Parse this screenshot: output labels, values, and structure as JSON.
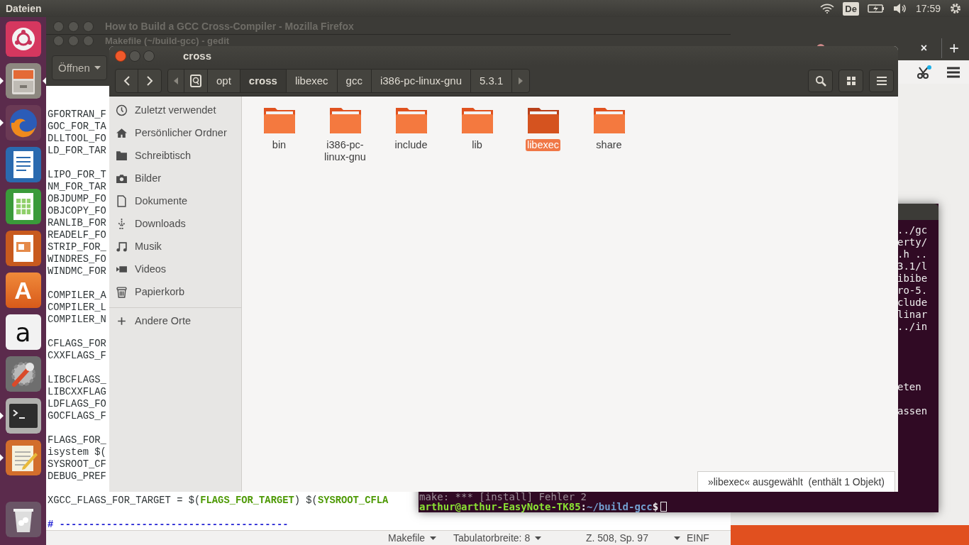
{
  "top_panel": {
    "app_name": "Dateien",
    "keyboard_layout": "De",
    "time": "17:59"
  },
  "launcher": [
    {
      "kind": "dash",
      "running": false,
      "focused": false
    },
    {
      "kind": "files",
      "running": true,
      "focused": true
    },
    {
      "kind": "browser",
      "running": true,
      "focused": false
    },
    {
      "kind": "writer",
      "running": false,
      "focused": false
    },
    {
      "kind": "calc",
      "running": false,
      "focused": false
    },
    {
      "kind": "impress",
      "running": false,
      "focused": false
    },
    {
      "kind": "software",
      "glyph": "A",
      "running": false,
      "focused": false
    },
    {
      "kind": "shop",
      "glyph": "a",
      "running": false,
      "focused": false
    },
    {
      "kind": "settings",
      "running": false,
      "focused": false
    },
    {
      "kind": "terminal",
      "running": true,
      "focused": false
    },
    {
      "kind": "editor",
      "running": true,
      "focused": false
    },
    {
      "kind": "trash",
      "running": false,
      "focused": false
    }
  ],
  "firefox": {
    "title": "How to Build a GCC Cross-Compiler - Mozilla Firefox",
    "tab_close": "×",
    "new_tab": "+"
  },
  "gedit": {
    "title": "Makefile (~/build-gcc) - gedit",
    "open_button": "Öffnen",
    "line_groups": [
      [
        "GFORTRAN_F",
        "GOC_FOR_TA",
        "DLLTOOL_FO",
        "LD_FOR_TAR"
      ],
      [
        "LIPO_FOR_T",
        "NM_FOR_TAR",
        "OBJDUMP_FO",
        "OBJCOPY_FO",
        "RANLIB_FOR",
        "READELF_FO",
        "STRIP_FOR_",
        "WINDRES_FO",
        "WINDMC_FOR"
      ],
      [
        "COMPILER_A",
        "COMPILER_L",
        "COMPILER_N"
      ],
      [
        "CFLAGS_FOR",
        "CXXFLAGS_F"
      ],
      [
        "LIBCFLAGS_",
        "LIBCXXFLAG",
        "LDFLAGS_FO",
        "GOCFLAGS_F"
      ],
      [
        "FLAGS_FOR_",
        "isystem $(",
        "SYSROOT_CF",
        "DEBUG_PREF"
      ],
      [
        "XGCC_FLAGS_FOR_TARGET = $(**FLAGS_FOR_TARGET**) $(**SYSROOT_CFLA**"
      ]
    ],
    "comment_line": "# ---------------------------------------",
    "status_bar": {
      "language": "Makefile",
      "tab_width": "Tabulatorbreite: 8",
      "position": "Z. 508, Sp. 97",
      "mode": "EINF"
    }
  },
  "terminal": {
    "fragment_groups": [
      [
        "../gc",
        "erty/",
        ".h ..",
        "3.1/l",
        "ibibe",
        "ro-5.",
        "clude",
        "linar",
        "../in"
      ],
      [
        "eten"
      ],
      [
        "assen"
      ]
    ],
    "error_line": "make: *** [install] Fehler 2",
    "prompt": [
      {
        "text": "arthur@arthur-EasyNote-TK85",
        "kind": "user"
      },
      {
        "text": ":",
        "kind": "plain"
      },
      {
        "text": "~/build-gcc",
        "kind": "path"
      },
      {
        "text": "$",
        "kind": "plain"
      }
    ]
  },
  "nautilus": {
    "title": "cross",
    "path": [
      {
        "label": "opt",
        "selected": false
      },
      {
        "label": "cross",
        "selected": true
      },
      {
        "label": "libexec",
        "selected": false
      },
      {
        "label": "gcc",
        "selected": false
      },
      {
        "label": "i386-pc-linux-gnu",
        "selected": false
      },
      {
        "label": "5.3.1",
        "selected": false
      }
    ],
    "sidebar": [
      {
        "label": "Zuletzt verwendet",
        "kind": "recent",
        "selected": false
      },
      {
        "label": "Persönlicher Ordner",
        "kind": "home",
        "selected": false
      },
      {
        "label": "Schreibtisch",
        "kind": "desktop",
        "selected": false
      },
      {
        "label": "Bilder",
        "kind": "pictures",
        "selected": false
      },
      {
        "label": "Dokumente",
        "kind": "documents",
        "selected": false
      },
      {
        "label": "Downloads",
        "kind": "downloads",
        "selected": false
      },
      {
        "label": "Musik",
        "kind": "music",
        "selected": false
      },
      {
        "label": "Videos",
        "kind": "videos",
        "selected": false
      },
      {
        "label": "Papierkorb",
        "kind": "trash",
        "selected": false
      }
    ],
    "other_places": "Andere Orte",
    "items": [
      {
        "name": "bin",
        "selected": false
      },
      {
        "name": "i386-pc-linux-gnu",
        "selected": false
      },
      {
        "name": "include",
        "selected": false
      },
      {
        "name": "lib",
        "selected": false
      },
      {
        "name": "libexec",
        "selected": true
      },
      {
        "name": "share",
        "selected": false
      }
    ],
    "status": "»libexec« ausgewählt  (enthält 1 Objekt)"
  }
}
